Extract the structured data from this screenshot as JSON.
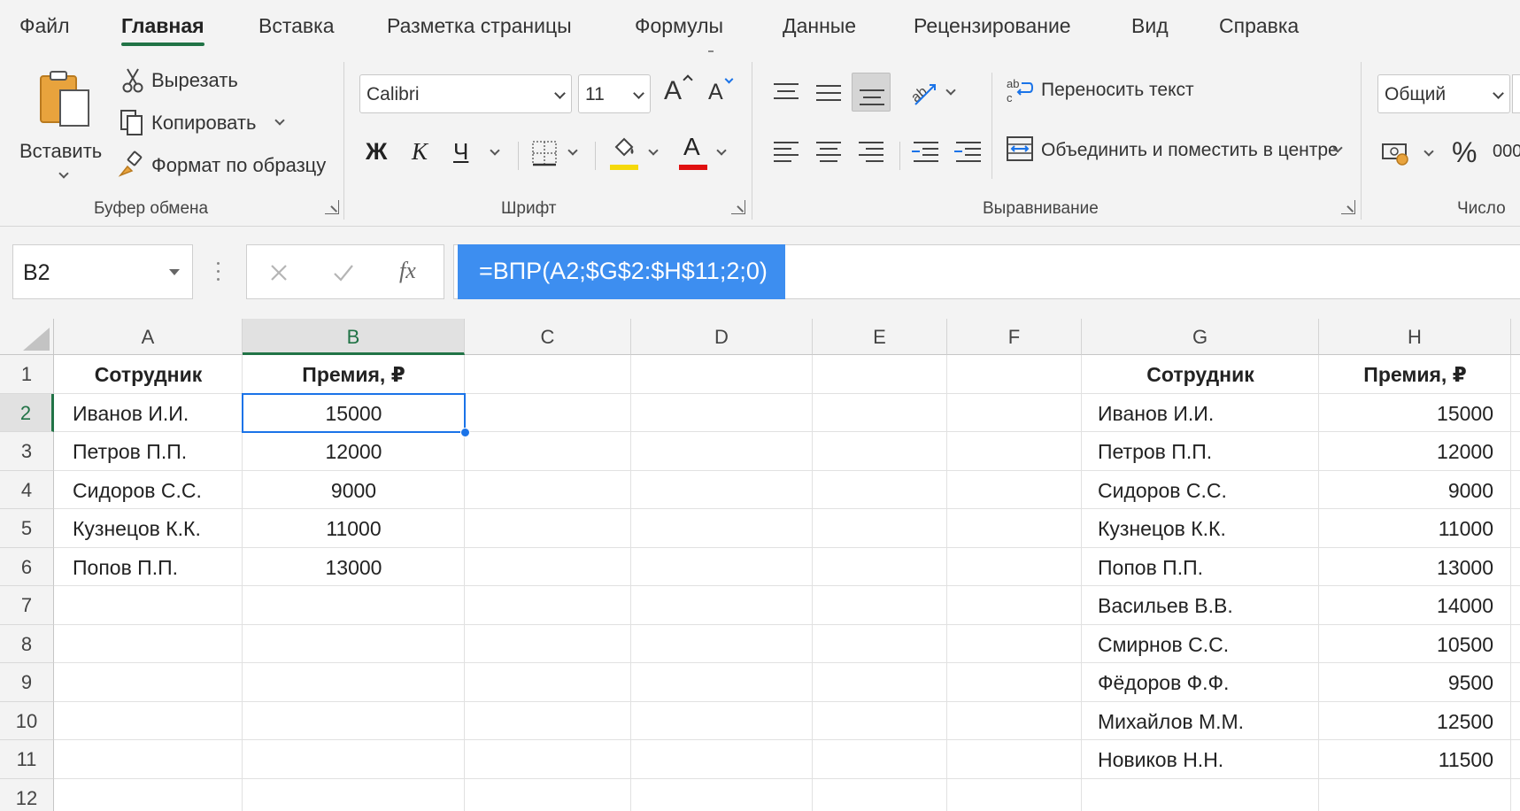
{
  "tabs": [
    "Файл",
    "Главная",
    "Вставка",
    "Разметка страницы",
    "Формулы",
    "Данные",
    "Рецензирование",
    "Вид",
    "Справка"
  ],
  "active_tab": "Главная",
  "ribbon": {
    "clipboard": {
      "paste_label": "Вставить",
      "cut_label": "Вырезать",
      "copy_label": "Копировать",
      "format_painter_label": "Формат по образцу",
      "group_label": "Буфер обмена"
    },
    "font": {
      "font_name": "Calibri",
      "font_size": "11",
      "bold_label": "Ж",
      "italic_label": "К",
      "underline_label": "Ч",
      "grow_label": "A",
      "shrink_label": "A",
      "font_color_label": "A",
      "group_label": "Шрифт",
      "fill_color": "#f5d90a",
      "font_color": "#e01010"
    },
    "alignment": {
      "wrap_text_label": "Переносить текст",
      "merge_center_label": "Объединить и поместить в центре",
      "group_label": "Выравнивание"
    },
    "number": {
      "format_value": "Общий",
      "percent_label": "%",
      "thousands_label": "000",
      "group_label": "Число"
    }
  },
  "formula_bar": {
    "name_box": "B2",
    "fx_label": "fx",
    "formula": "=ВПР(A2;$G$2:$H$11;2;0)"
  },
  "grid": {
    "columns": [
      "A",
      "B",
      "C",
      "D",
      "E",
      "F",
      "G",
      "H"
    ],
    "rows": [
      "1",
      "2",
      "3",
      "4",
      "5",
      "6",
      "7",
      "8",
      "9",
      "10",
      "11",
      "12"
    ],
    "selected_cell": "B2",
    "left_table": {
      "header": [
        "Сотрудник",
        "Премия, ₽"
      ],
      "rows": [
        [
          "Иванов И.И.",
          "15000"
        ],
        [
          "Петров П.П.",
          "12000"
        ],
        [
          "Сидоров С.С.",
          "9000"
        ],
        [
          "Кузнецов К.К.",
          "11000"
        ],
        [
          "Попов П.П.",
          "13000"
        ]
      ]
    },
    "right_table": {
      "header": [
        "Сотрудник",
        "Премия, ₽"
      ],
      "rows": [
        [
          "Иванов И.И.",
          "15000"
        ],
        [
          "Петров П.П.",
          "12000"
        ],
        [
          "Сидоров С.С.",
          "9000"
        ],
        [
          "Кузнецов К.К.",
          "11000"
        ],
        [
          "Попов П.П.",
          "13000"
        ],
        [
          "Васильев В.В.",
          "14000"
        ],
        [
          "Смирнов С.С.",
          "10500"
        ],
        [
          "Фёдоров Ф.Ф.",
          "9500"
        ],
        [
          "Михайлов М.М.",
          "12500"
        ],
        [
          "Новиков Н.Н.",
          "11500"
        ]
      ]
    }
  }
}
